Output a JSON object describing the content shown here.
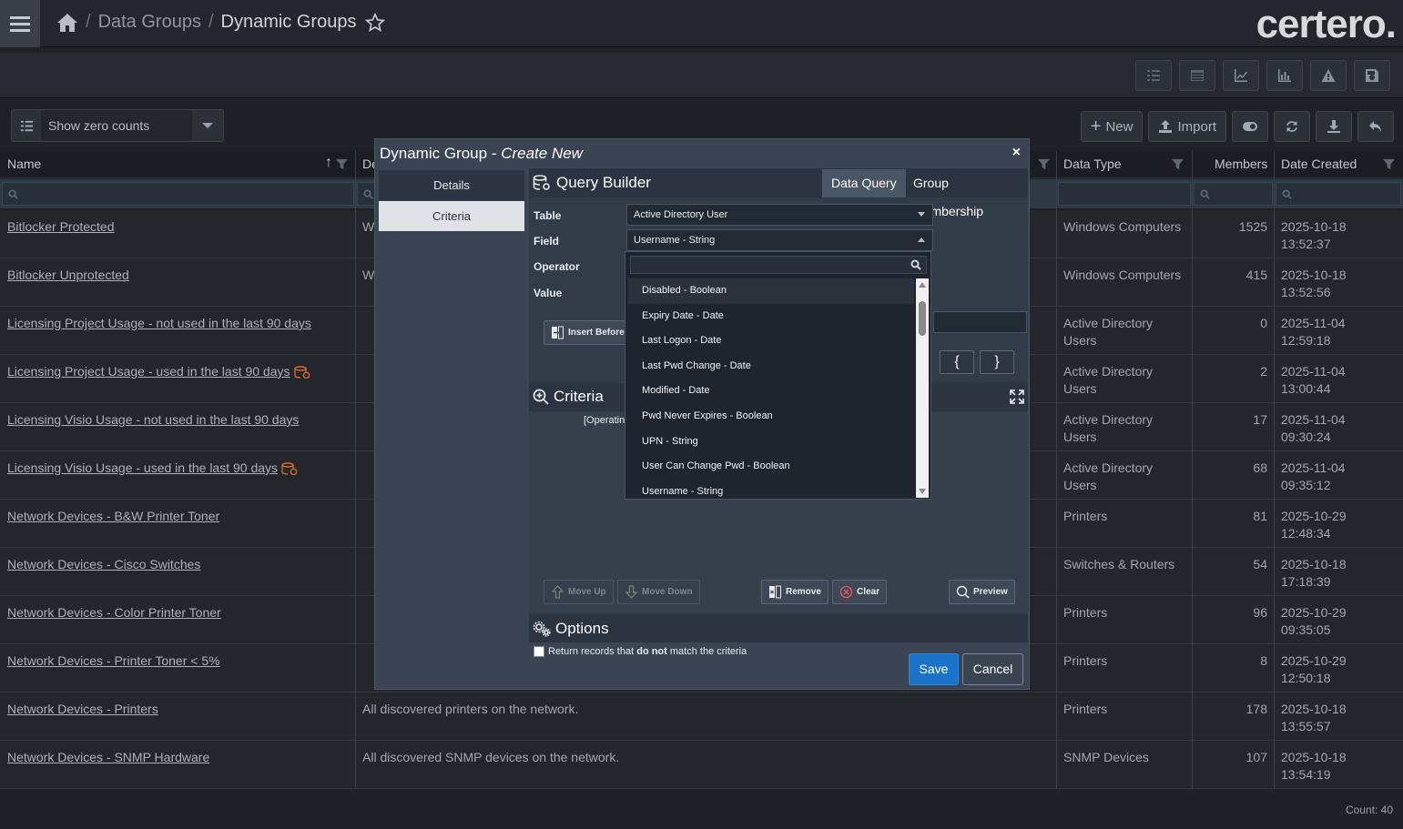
{
  "breadcrumb": {
    "section": "Data Groups",
    "current": "Dynamic Groups"
  },
  "brand": {
    "logo_text": "certero."
  },
  "filter": {
    "zero_counts_label": "Show zero counts"
  },
  "actions": {
    "new_label": "New",
    "import_label": "Import"
  },
  "table": {
    "headers": {
      "name": "Name",
      "description": "De",
      "data_type": "Data Type",
      "members": "Members",
      "date_created": "Date Created"
    },
    "rows": [
      {
        "name": "Bitlocker Protected",
        "description": "W",
        "data_type": "Windows Computers",
        "members": "1525",
        "date": "2025-10-18",
        "time": "13:52:37"
      },
      {
        "name": "Bitlocker Unprotected",
        "description": "W",
        "data_type": "Windows Computers",
        "members": "415",
        "date": "2025-10-18",
        "time": "13:52:56"
      },
      {
        "name": "Licensing Project Usage - not used in the last 90 days",
        "description": "",
        "data_type": "Active Directory Users",
        "members": "0",
        "date": "2025-11-04",
        "time": "12:59:18"
      },
      {
        "name": "Licensing Project Usage - used in the last 90 days",
        "description": "",
        "data_type": "Active Directory Users",
        "members": "2",
        "date": "2025-11-04",
        "time": "13:00:44"
      },
      {
        "name": "Licensing Visio Usage - not used in the last 90 days",
        "description": "",
        "data_type": "Active Directory Users",
        "members": "17",
        "date": "2025-11-04",
        "time": "09:30:24"
      },
      {
        "name": "Licensing Visio Usage - used in the last 90 days",
        "description": "",
        "data_type": "Active Directory Users",
        "members": "68",
        "date": "2025-11-04",
        "time": "09:35:12"
      },
      {
        "name": "Network Devices - B&W Printer Toner",
        "description": "",
        "data_type": "Printers",
        "members": "81",
        "date": "2025-10-29",
        "time": "12:48:34"
      },
      {
        "name": "Network Devices - Cisco Switches",
        "description": "",
        "data_type": "Switches & Routers",
        "members": "54",
        "date": "2025-10-18",
        "time": "17:18:39"
      },
      {
        "name": "Network Devices - Color Printer Toner",
        "description": "",
        "data_type": "Printers",
        "members": "96",
        "date": "2025-10-29",
        "time": "09:35:05"
      },
      {
        "name": "Network Devices - Printer Toner < 5%",
        "description": "",
        "data_type": "Printers",
        "members": "8",
        "date": "2025-10-29",
        "time": "12:50:18"
      },
      {
        "name": "Network Devices - Printers",
        "description": "All discovered printers on the network.",
        "data_type": "Printers",
        "members": "178",
        "date": "2025-10-18",
        "time": "13:55:57"
      },
      {
        "name": "Network Devices - SNMP Hardware",
        "description": "All discovered SNMP devices on the network.",
        "data_type": "SNMP Devices",
        "members": "107",
        "date": "2025-10-18",
        "time": "13:54:19"
      }
    ],
    "count_label": "Count: 40"
  },
  "modal": {
    "title": "Dynamic Group - ",
    "title_em": "Create New",
    "close": "×",
    "tabs": [
      "Details",
      "Criteria"
    ],
    "query_builder": {
      "title": "Query Builder",
      "tabs": [
        "Data Query",
        "Group Membership"
      ],
      "labels": {
        "table": "Table",
        "field": "Field",
        "operator": "Operator",
        "value": "Value"
      },
      "table_value": "Active Directory User",
      "field_value": "Username - String",
      "insert_before": "Insert Before",
      "brace_open": "{",
      "brace_close": "}"
    },
    "dropdown_options": [
      "Disabled - Boolean",
      "Expiry Date - Date",
      "Last Logon - Date",
      "Last Pwd Change - Date",
      "Modified - Date",
      "Pwd Never Expires - Boolean",
      "UPN - String",
      "User Can Change Pwd - Boolean",
      "Username - String"
    ],
    "criteria": {
      "title": "Criteria",
      "sub": "[Operatin",
      "buttons": {
        "move_up": "Move Up",
        "move_down": "Move Down",
        "remove": "Remove",
        "clear": "Clear",
        "preview": "Preview"
      }
    },
    "options": {
      "title": "Options",
      "text_before": "Return records that ",
      "text_bold": "do not",
      "text_after": " match the criteria"
    },
    "save": "Save",
    "cancel": "Cancel"
  }
}
